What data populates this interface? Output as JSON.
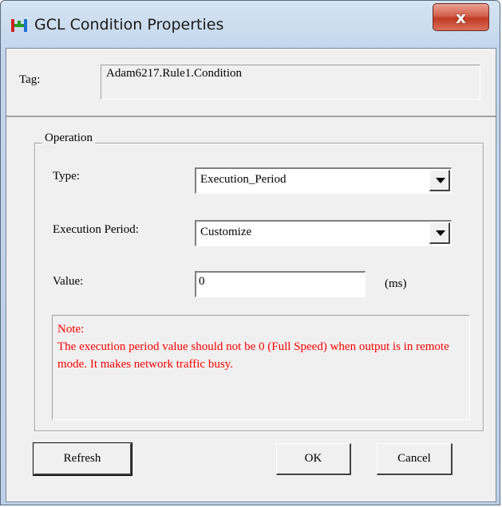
{
  "window": {
    "title": "GCL Condition Properties",
    "close_glyph": "x"
  },
  "tag": {
    "label": "Tag:",
    "value": "Adam6217.Rule1.Condition"
  },
  "operation": {
    "group_title": "Operation",
    "type_label": "Type:",
    "type_value": "Execution_Period",
    "period_label": "Execution Period:",
    "period_value": "Customize",
    "value_label": "Value:",
    "value_input": "0",
    "value_unit": "(ms)"
  },
  "note": {
    "heading": "Note:",
    "text": "The execution period value should not be 0 (Full Speed) when output is in remote mode. It makes network traffic busy."
  },
  "buttons": {
    "refresh": "Refresh",
    "ok": "OK",
    "cancel": "Cancel"
  },
  "colors": {
    "note_text": "#ff0000",
    "close_button": "#c13a22"
  }
}
